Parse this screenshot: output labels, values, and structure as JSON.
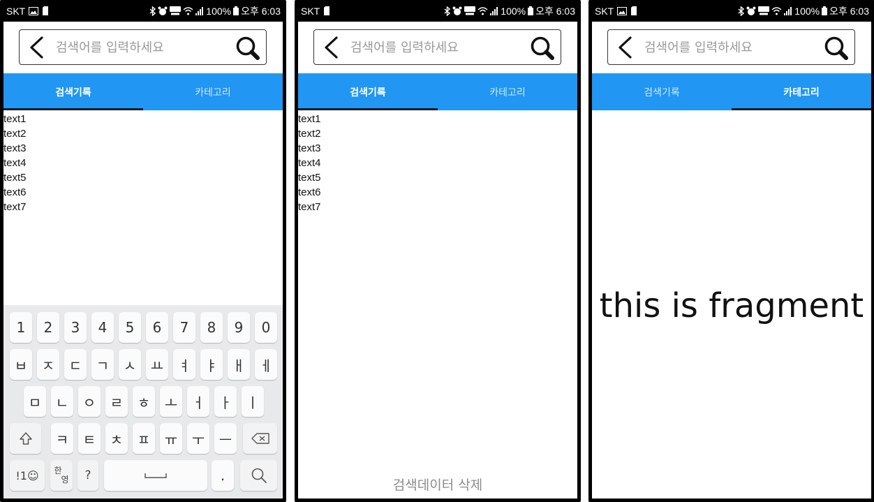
{
  "status_bar": {
    "carrier": "SKT",
    "battery_percent": "100%",
    "time": "오후 6:03"
  },
  "search": {
    "placeholder": "검색어를 입력하세요"
  },
  "tabs": {
    "history_label": "검색기록",
    "category_label": "카테고리"
  },
  "history_items": [
    "text1",
    "text2",
    "text3",
    "text4",
    "text5",
    "text6",
    "text7"
  ],
  "keyboard": {
    "row_numbers": [
      "1",
      "2",
      "3",
      "4",
      "5",
      "6",
      "7",
      "8",
      "9",
      "0"
    ],
    "row_1": [
      "ㅂ",
      "ㅈ",
      "ㄷ",
      "ㄱ",
      "ㅅ",
      "ㅛ",
      "ㅕ",
      "ㅑ",
      "ㅐ",
      "ㅔ"
    ],
    "row_2": [
      "ㅁ",
      "ㄴ",
      "ㅇ",
      "ㄹ",
      "ㅎ",
      "ㅗ",
      "ㅓ",
      "ㅏ",
      "ㅣ"
    ],
    "row_3": [
      "ㅋ",
      "ㅌ",
      "ㅊ",
      "ㅍ",
      "ㅠ",
      "ㅜ",
      "ㅡ"
    ],
    "symbols_label": "!1☺",
    "lang_label_top": "한",
    "lang_label_bottom": "영",
    "question_label": "?",
    "period_label": "."
  },
  "delete_button_label": "검색데이터 삭제",
  "fragment_text": "this is fragment",
  "colors": {
    "tab_bar": "#2196f3",
    "status_bar": "#000000",
    "keyboard_bg": "#e8e9eb"
  }
}
